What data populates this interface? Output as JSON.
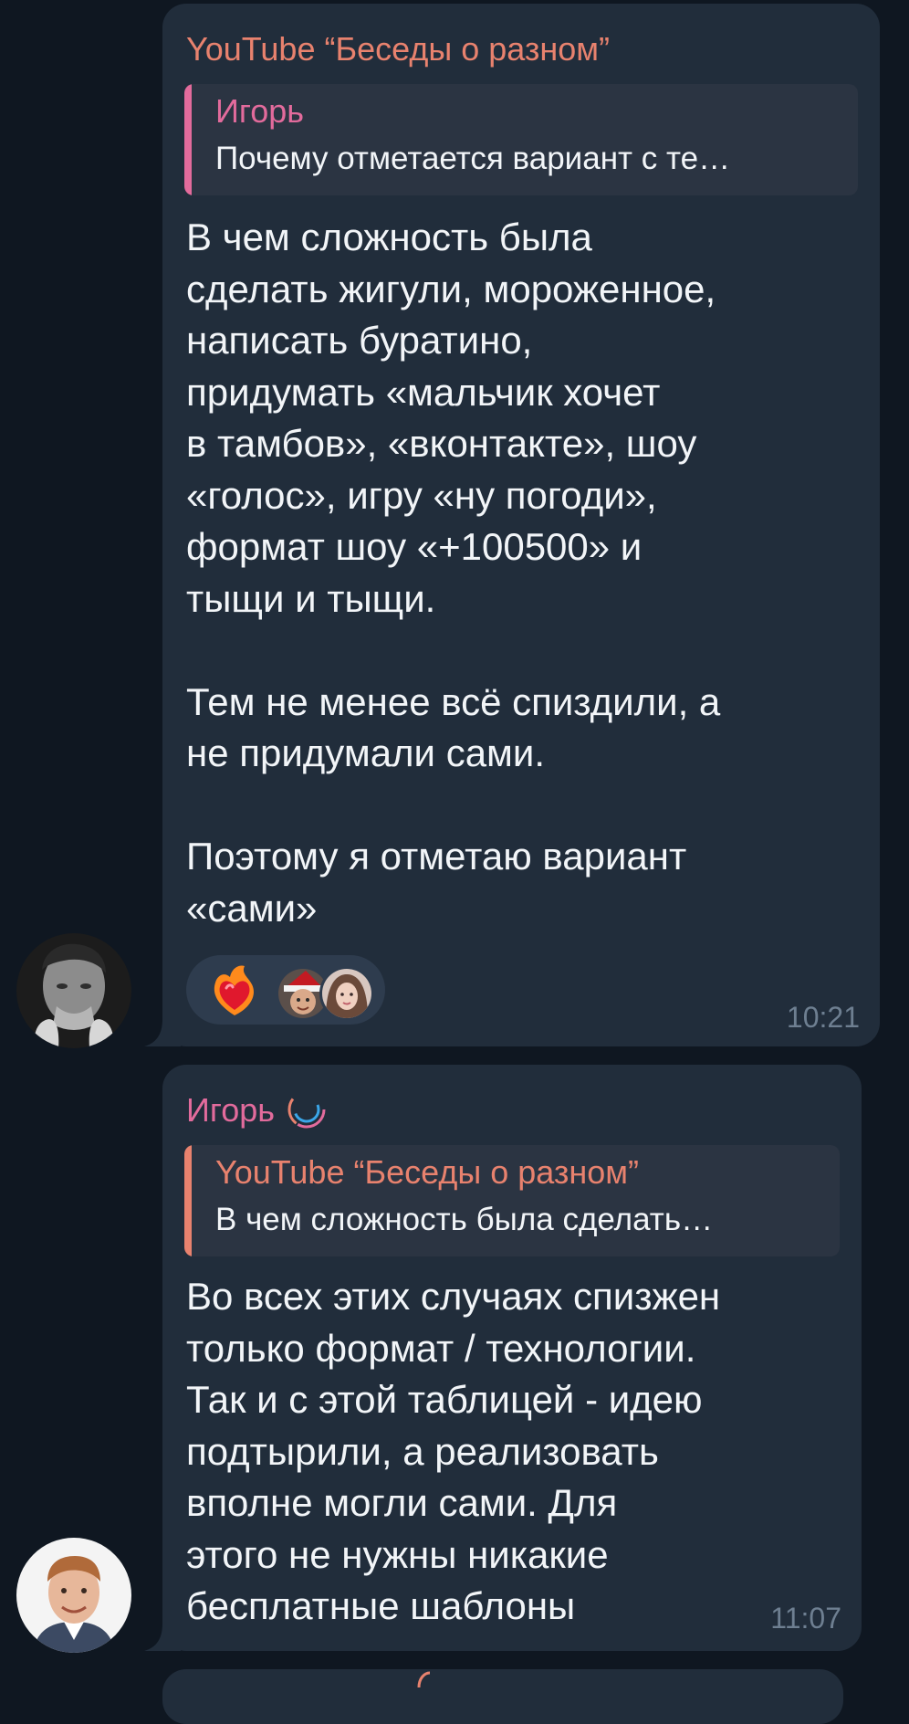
{
  "messages": [
    {
      "sender": "YouTube “Беседы о разном”",
      "reply": {
        "name": "Игорь",
        "text": "Почему отметается вариант с те…"
      },
      "body": "В чем сложность была\nсделать жигули, мороженное,\nнаписать буратино,\nпридумать «мальчик хочет\nв тамбов», «вконтакте», шоу\n«голос», игру «ну погоди»,\nформат шоу «+100500» и\nтыщи и тыщи.\n\nТем не менее всё спиздили, а\nне придумали сами.\n\nПоэтому я отметаю вариант\n«сами»",
      "time": "10:21",
      "reactions": [
        "heart-on-fire"
      ]
    },
    {
      "sender": "Игорь",
      "reply": {
        "name": "YouTube “Беседы о разном”",
        "text": "В чем сложность была сделать…"
      },
      "body": "Во всех этих случаях спизжен\nтолько формат / технологии.\nТак и с этой таблицей - идею\nподтырили, а реализовать\nвполне могли сами. Для\nэтого не нужны никакие\nбесплатные шаблоны",
      "time": "11:07"
    }
  ],
  "colors": {
    "background": "#0f1721",
    "bubble": "#212d3b",
    "youtube_name": "#e8826e",
    "igor_name": "#e26b9c",
    "time": "#6e7f91"
  }
}
